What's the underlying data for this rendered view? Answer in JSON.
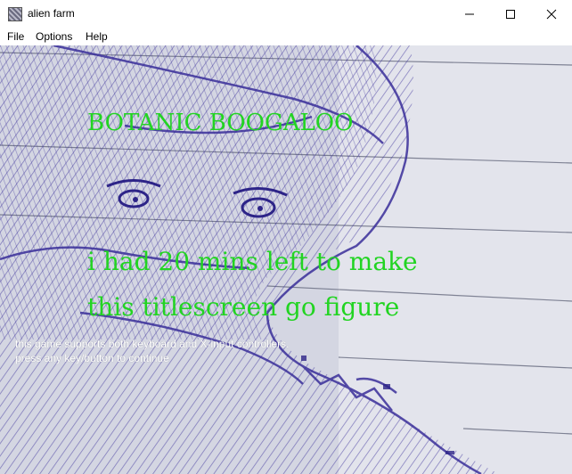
{
  "window": {
    "title": "alien farm",
    "icon": "app-icon"
  },
  "menu": {
    "items": [
      "File",
      "Options",
      "Help"
    ]
  },
  "game": {
    "title": "BOTANIC BOOGALOO",
    "caption_line1": "i had 20 mins left to make",
    "caption_line2": "this titlescreen go figure",
    "info_line1": "this game supports both keyboard and X-input controllers.",
    "info_line2": "press any key/button to continue",
    "colors": {
      "title_green": "#22d422",
      "ink": "#3a2f9a",
      "paper": "#d4d6e2"
    }
  }
}
